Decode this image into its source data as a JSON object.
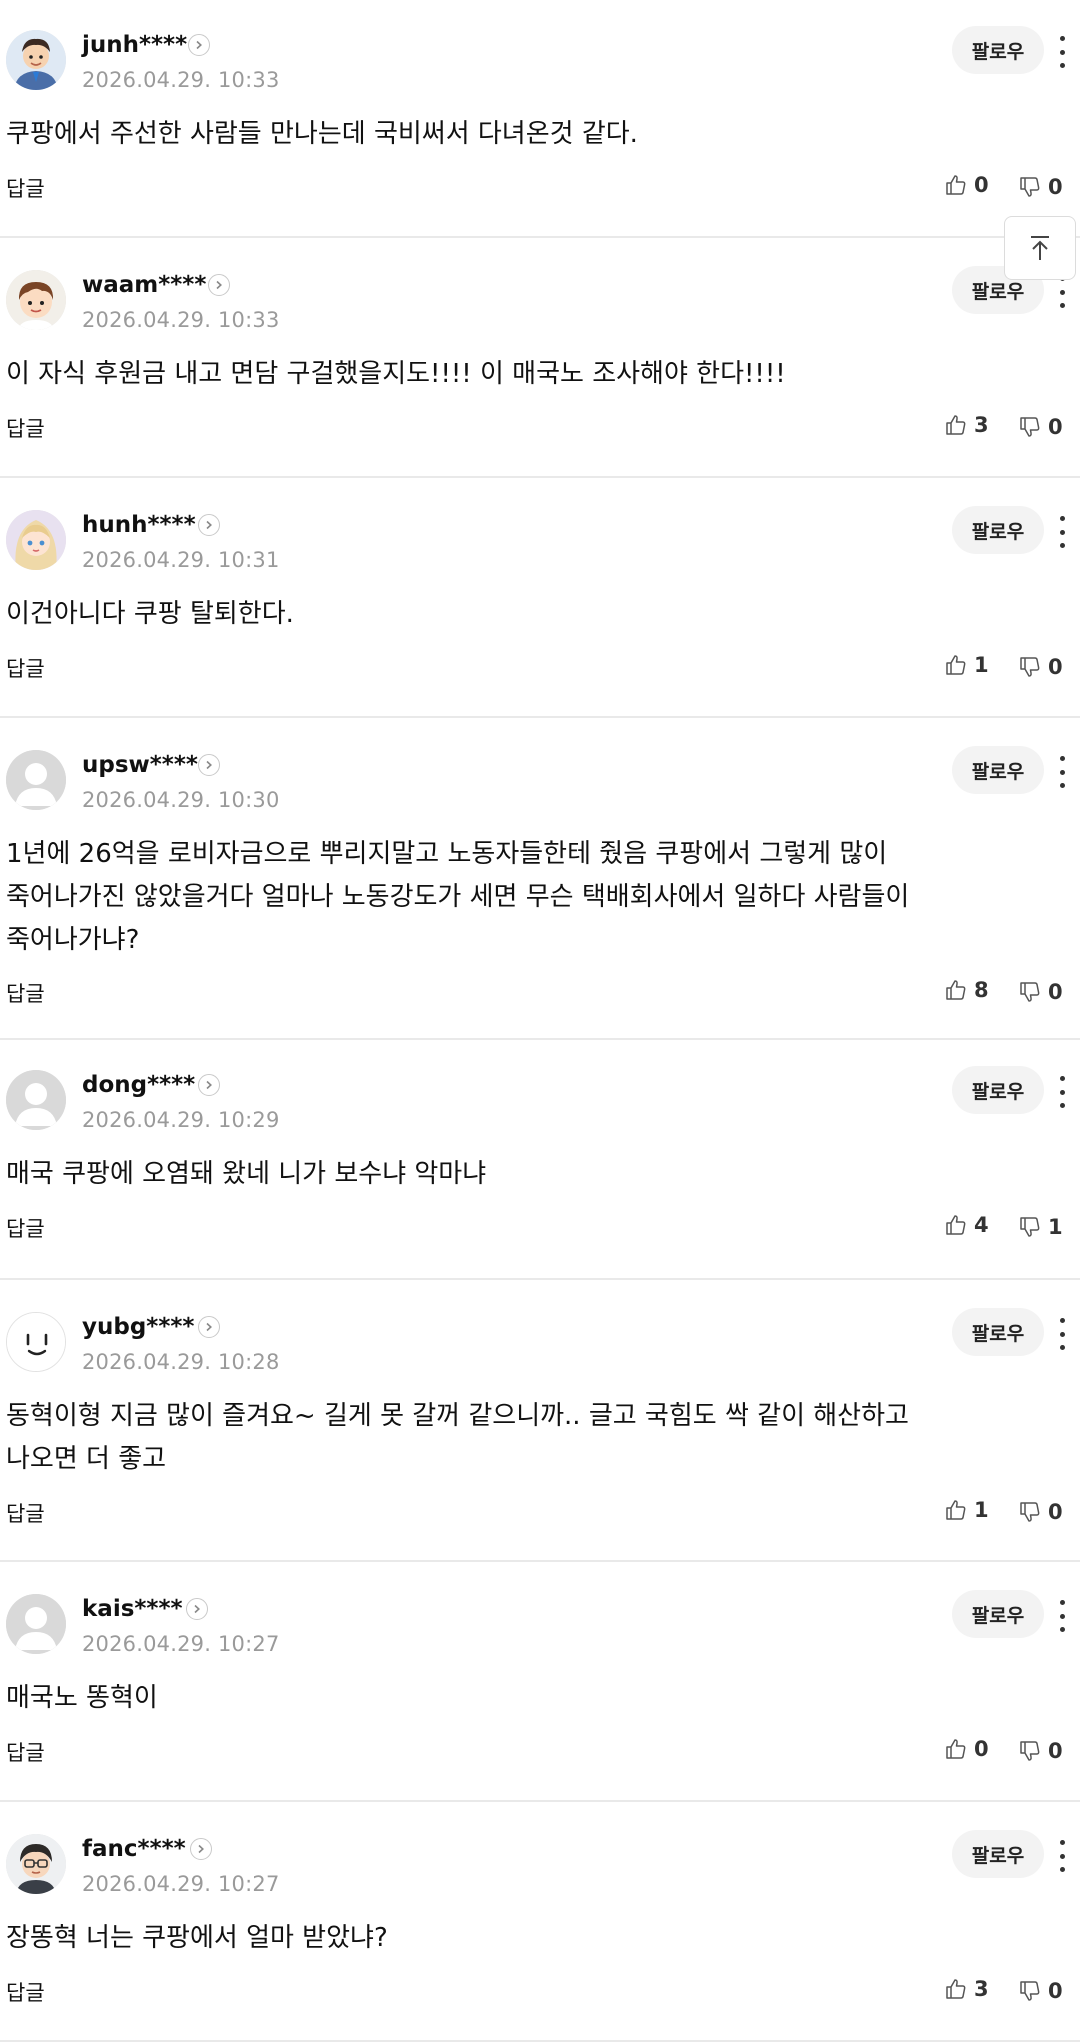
{
  "follow_label": "팔로우",
  "reply_label": "답글",
  "comments": [
    {
      "user": "junh****",
      "time": "2026.04.29. 10:33",
      "text": [
        "쿠팡에서 주선한 사람들 만나는데 국비써서 다녀온것 같다."
      ],
      "likes": "0",
      "dislikes": "0",
      "avatar": "man-suit-avatar"
    },
    {
      "user": "waam****",
      "time": "2026.04.29. 10:33",
      "text": [
        "이 자식 후원금 내고 면담 구걸했을지도!!!! 이 매국노 조사해야 한다!!!!"
      ],
      "likes": "3",
      "dislikes": "0",
      "avatar": "boy-avatar"
    },
    {
      "user": "hunh****",
      "time": "2026.04.29. 10:31",
      "text": [
        "이건아니다 쿠팡 탈퇴한다."
      ],
      "likes": "1",
      "dislikes": "0",
      "avatar": "girl-avatar"
    },
    {
      "user": "upsw****",
      "time": "2026.04.29. 10:30",
      "text": [
        "1년에 26억을 로비자금으로 뿌리지말고 노동자들한테 줬음 쿠팡에서 그렇게 많이",
        "죽어나가진 않았을거다 얼마나 노동강도가 세면 무슨 택배회사에서 일하다 사람들이",
        "죽어나가냐?"
      ],
      "likes": "8",
      "dislikes": "0",
      "avatar": "default-avatar"
    },
    {
      "user": "dong****",
      "time": "2026.04.29. 10:29",
      "text": [
        "매국 쿠팡에 오염돼 왔네 니가 보수냐 악마냐"
      ],
      "likes": "4",
      "dislikes": "1",
      "avatar": "default-avatar"
    },
    {
      "user": "yubg****",
      "time": "2026.04.29. 10:28",
      "text": [
        "동혁이형 지금 많이 즐겨요~ 길게 못 갈꺼 같으니까.. 글고 국힘도 싹 같이 해산하고",
        "나오면 더 좋고"
      ],
      "likes": "1",
      "dislikes": "0",
      "avatar": "smiley-avatar"
    },
    {
      "user": "kais****",
      "time": "2026.04.29. 10:27",
      "text": [
        "매국노 똥혁이"
      ],
      "likes": "0",
      "dislikes": "0",
      "avatar": "default-avatar"
    },
    {
      "user": "fanc****",
      "time": "2026.04.29. 10:27",
      "text": [
        "장똥혁 너는 쿠팡에서 얼마 받았냐?"
      ],
      "likes": "3",
      "dislikes": "0",
      "avatar": "glasses-man-avatar"
    }
  ],
  "scroll_top_icon": "arrow-up-to-top-icon"
}
